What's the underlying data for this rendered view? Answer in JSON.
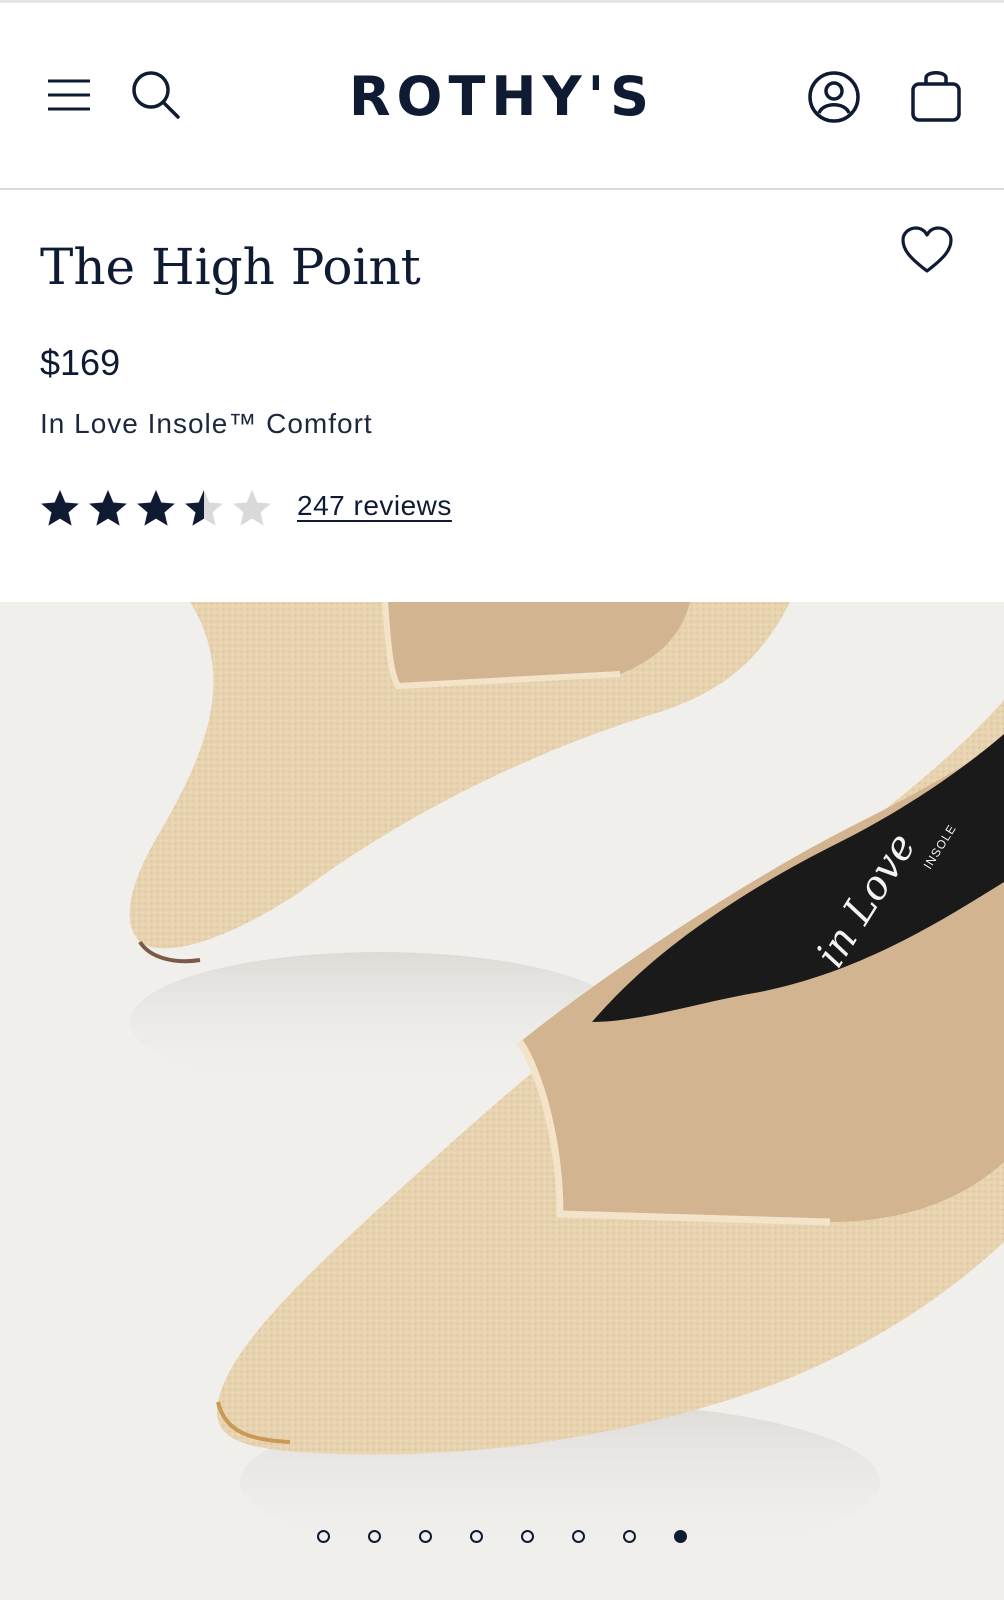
{
  "header": {
    "logo": "ROTHY'S",
    "icons": [
      "menu-icon",
      "search-icon",
      "account-icon",
      "bag-icon"
    ]
  },
  "product": {
    "title": "The High Point",
    "price": "$169",
    "tagline": "In Love Insole™ Comfort",
    "rating": {
      "value": 3.5,
      "max": 5
    },
    "reviews_label": "247 reviews",
    "image_insole_text": "in Love",
    "image_insole_subtext": "INSOLE"
  },
  "carousel": {
    "total": 8,
    "active_index": 7
  },
  "colors": {
    "navy": "#0f1b33",
    "star_empty": "#d9d9d9",
    "shoe": "#e8d3b0",
    "insole": "#d2b490",
    "background": "#f0efec"
  }
}
